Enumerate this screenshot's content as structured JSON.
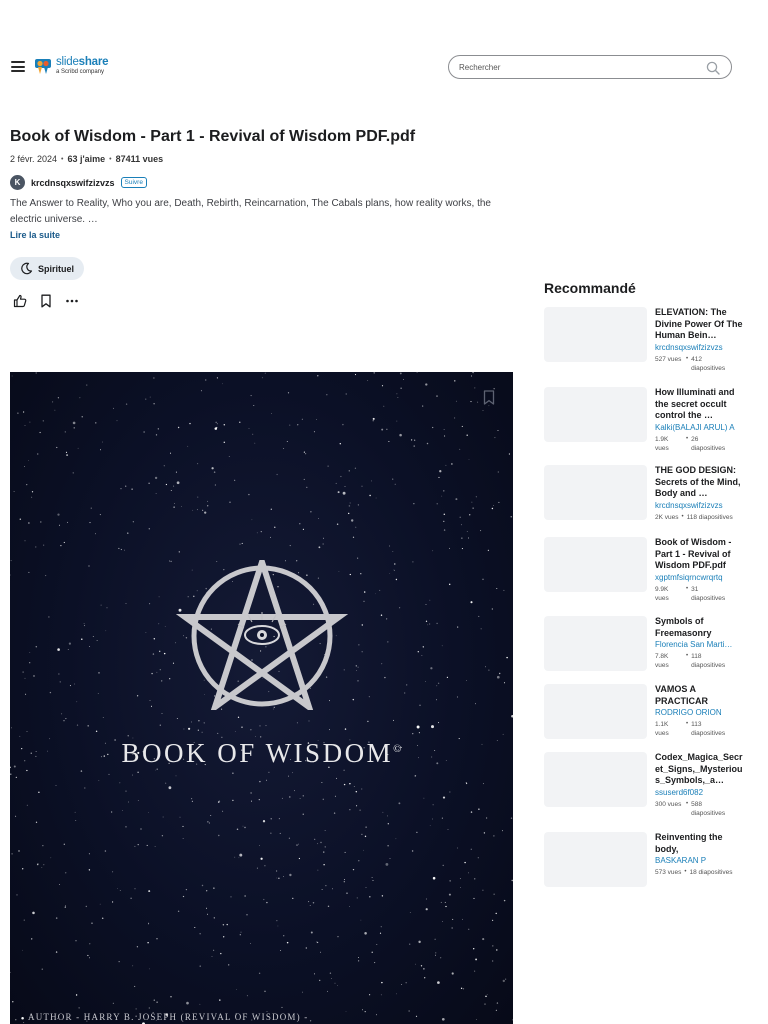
{
  "header": {
    "logo_brand_light": "slide",
    "logo_brand_bold": "share",
    "logo_sub": "a Scribd company",
    "search_placeholder": "Rechercher"
  },
  "document": {
    "title": "Book of Wisdom - Part 1 - Revival of Wisdom PDF.pdf",
    "date": "2 févr. 2024",
    "likes": "63 j'aime",
    "views": "87411 vues",
    "author_initial": "K",
    "author": "krcdnsqxswifzizvzs",
    "follow_label": "Suivre",
    "description": "The Answer to Reality, Who you are, Death, Rebirth, Reincarnation, The Cabals plans, how reality works, the electric universe. …",
    "read_more": "Lire la suite",
    "tag": "Spirituel"
  },
  "slide": {
    "book_title": "BOOK OF WISDOM",
    "copyright": "©",
    "author_line": "AUTHOR - HARRY B. JOSEPH (REVIVAL OF WISDOM) -"
  },
  "recommended": {
    "heading": "Recommandé",
    "items": [
      {
        "title": "ELEVATION: The Divine Power Of The Human Bein…",
        "author": "krcdnsqxswifzizvzs",
        "views": "527 vues",
        "slides": "412 diapositives"
      },
      {
        "title": "How Illuminati and the secret occult control the …",
        "author": "Kalki(BALAJI ARUL) A",
        "views": "1.9K vues",
        "slides": "26 diapositives"
      },
      {
        "title": "THE GOD DESIGN: Secrets of the Mind, Body and …",
        "author": "krcdnsqxswifzizvzs",
        "views": "2K vues",
        "slides": "118 diapositives"
      },
      {
        "title": "Book of Wisdom - Part 1 - Revival of Wisdom PDF.pdf",
        "author": "xgptmfsiqrncwrqrtq",
        "views": "9.9K vues",
        "slides": "31 diapositives"
      },
      {
        "title": "Symbols of Freemasonry",
        "author": "Florencia San Marti…",
        "views": "7.8K vues",
        "slides": "118 diapositives"
      },
      {
        "title": "VAMOS A PRACTICAR",
        "author": "RODRIGO ORION",
        "views": "1.1K vues",
        "slides": "113 diapositives"
      },
      {
        "title": "Codex_Magica_Secret_Signs,_Mysterious_Symbols,_a…",
        "author": "ssuserd6f082",
        "views": "300 vues",
        "slides": "588 diapositives"
      },
      {
        "title": "Reinventing the body,",
        "author": "BASKARAN P",
        "views": "573 vues",
        "slides": "18 diapositives"
      }
    ]
  }
}
